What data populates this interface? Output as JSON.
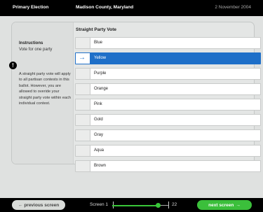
{
  "header": {
    "election": "Primary Election",
    "county": "Madison County, Maryland",
    "date": "2 November 2004"
  },
  "instructions": {
    "title": "Instructions",
    "subtitle": "Vote for one party",
    "alert_symbol": "!",
    "body": "A straight party vote will apply to all partisan contests in this ballot. However, you are allowed to overide your straight party vote within each individual contest."
  },
  "contest": {
    "title": "Straight Party Vote",
    "options": [
      "Blue",
      "Yellow",
      "Purple",
      "Orange",
      "Pink",
      "Gold",
      "Gray",
      "Aqua",
      "Brown"
    ],
    "selected": "Yellow"
  },
  "footer": {
    "previous_label": "previous screen",
    "next_label": "next screen",
    "screen_label": "Screen 1",
    "screen_total": "22",
    "progress_fraction": 0.82
  },
  "colors": {
    "accent": "#1e6fc8",
    "go": "#3bbf3b"
  }
}
